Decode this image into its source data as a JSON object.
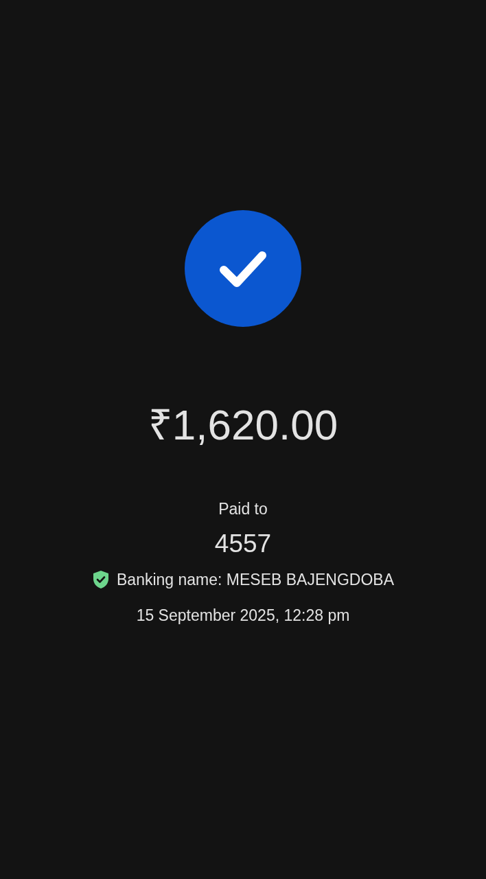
{
  "status": {
    "kind": "success"
  },
  "amount": "₹1,620.00",
  "paid_to_label": "Paid to",
  "payee": "4557",
  "banking_name": {
    "verified": true,
    "text": "Banking name: MESEB BAJENGDOBA"
  },
  "timestamp": "15 September 2025, 12:28 pm"
}
